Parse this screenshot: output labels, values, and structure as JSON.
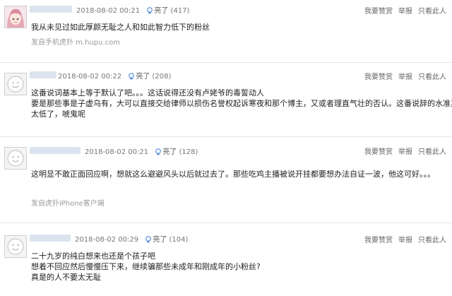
{
  "comments": [
    {
      "date": "2018-08-02 00:21",
      "light_label": "亮了",
      "light_count": "(417)",
      "actions": [
        "我要赞赏",
        "举报",
        "只看此人"
      ],
      "lines": [
        "我从未见过如此厚颜无耻之人和如此智力低下的粉丝"
      ],
      "source": "发自手机虎扑 m.hupu.com",
      "avatar": "anime-girl-avatar"
    },
    {
      "date": "2018-08-02 00:22",
      "light_label": "亮了",
      "light_count": "(208)",
      "actions": [
        "我要赞赏",
        "举报",
        "只看此人"
      ],
      "lines": [
        "这番说词基本上等于默认了吧。。。这话说得还没有卢姥爷的毒誓动人",
        "要是那些事是子虚乌有，大可以直接交给律师以损伤名誉权起诉寒夜和那个博主，又或者理直气壮的否认。这番说辞的水准真是",
        "太低了，唬鬼呢"
      ],
      "source": "",
      "avatar": "default-avatar"
    },
    {
      "date": "2018-08-02 00:21",
      "light_label": "亮了",
      "light_count": "(128)",
      "actions": [
        "我要赞赏",
        "举报",
        "只看此人"
      ],
      "lines": [
        "这明显不敢正面回应啊，想就这么避避风头以后就过去了。那些吃鸡主播被说开挂都要想办法自证一波，他这可好。。。"
      ],
      "source": "发自虎扑iPhone客户端",
      "avatar": "default-avatar"
    },
    {
      "date": "2018-08-02 00:29",
      "light_label": "亮了",
      "light_count": "(104)",
      "actions": [
        "我要赞赏",
        "举报",
        "只看此人"
      ],
      "lines": [
        "二十九岁的纯白想来也还是个孩子吧",
        "想着不回应然后慢慢压下来，继续骗那些未成年和刚成年的小粉丝?",
        "真是的人不要太无耻"
      ],
      "source": "",
      "avatar": "default-avatar"
    }
  ]
}
